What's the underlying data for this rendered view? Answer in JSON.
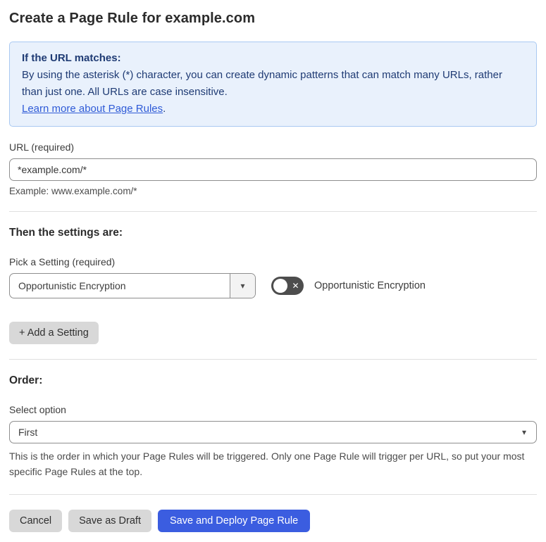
{
  "page": {
    "title": "Create a Page Rule for example.com"
  },
  "info_box": {
    "heading": "If the URL matches:",
    "body": "By using the asterisk (*) character, you can create dynamic patterns that can match many URLs, rather than just one. All URLs are case insensitive.",
    "link_label": "Learn more about Page Rules",
    "link_suffix": "."
  },
  "url_field": {
    "label": "URL (required)",
    "value": "*example.com/*",
    "helper": "Example: www.example.com/*"
  },
  "settings_section": {
    "heading": "Then the settings are:",
    "picker_label": "Pick a Setting (required)",
    "picker_value": "Opportunistic Encryption",
    "toggle_state": "off",
    "toggle_label": "Opportunistic Encryption",
    "add_button_label": "+ Add a Setting"
  },
  "order_section": {
    "heading": "Order:",
    "select_label": "Select option",
    "select_value": "First",
    "helper": "This is the order in which your Page Rules will be triggered. Only one Page Rule will trigger per URL, so put your most specific Page Rules at the top."
  },
  "footer": {
    "cancel_label": "Cancel",
    "save_draft_label": "Save as Draft",
    "save_deploy_label": "Save and Deploy Page Rule"
  },
  "icons": {
    "dropdown_caret": "▾",
    "toggle_x": "✕"
  },
  "colors": {
    "info_bg": "#e9f1fc",
    "info_border": "#a9c9f2",
    "info_text": "#1f3b74",
    "link": "#2f5bd7",
    "primary_button": "#3b5de0",
    "secondary_button": "#d8d8d8",
    "toggle_off": "#4d4d4d",
    "input_border": "#8e8e8e"
  }
}
